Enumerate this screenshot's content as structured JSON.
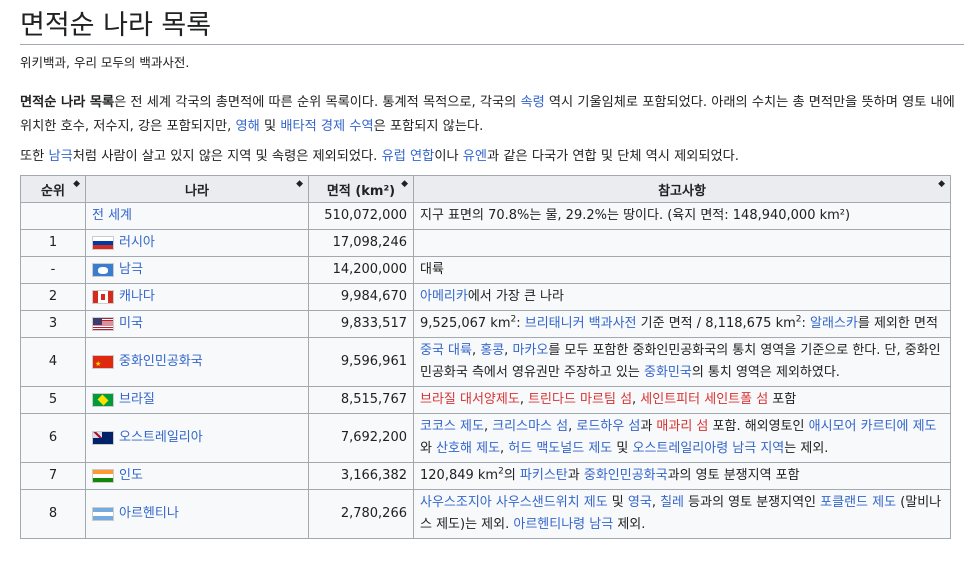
{
  "title": "면적순 나라 목록",
  "tagline": "위키백과, 우리 모두의 백과사전.",
  "intro": {
    "p1_bold": "면적순 나라 목록",
    "p1_a": "은 전 세계 각국의 총면적에 따른 순위 목록이다. 통계적 목적으로, 각국의 ",
    "p1_link1": "속령",
    "p1_b": " 역시 기울임체로 포함되었다. 아래의 수치는 총 면적만을 뜻하며 영토 내에 위치한 호수, 저수지, 강은 포함되지만, ",
    "p1_link2": "영해",
    "p1_c": " 및 ",
    "p1_link3": "배타적 경제 수역",
    "p1_d": "은 포함되지 않는다.",
    "p2_a": "또한 ",
    "p2_link1": "남극",
    "p2_b": "처럼 사람이 살고 있지 않은 지역 및 속령은 제외되었다. ",
    "p2_link2": "유럽 연합",
    "p2_c": "이나 ",
    "p2_link3": "유엔",
    "p2_d": "과 같은 다국가 연합 및 단체 역시 제외되었다."
  },
  "table": {
    "headers": {
      "rank": "순위",
      "country": "나라",
      "area": "면적 (km²)",
      "notes": "참고사항"
    },
    "sort_icon": "◆",
    "rows": [
      {
        "rank": "",
        "country": "전 세계",
        "flag": "",
        "area": "510,072,000",
        "notes": "지구 표면의 70.8%는 물, 29.2%는 땅이다. (육지 면적: 148,940,000 km²)"
      },
      {
        "rank": "1",
        "country": "러시아",
        "flag": "ru",
        "area": "17,098,246",
        "notes": ""
      },
      {
        "rank": "-",
        "country": "남극",
        "flag": "aq",
        "area": "14,200,000",
        "notes": "대륙"
      },
      {
        "rank": "2",
        "country": "캐나다",
        "flag": "ca",
        "area": "9,984,670",
        "notes": ""
      },
      {
        "rank": "3",
        "country": "미국",
        "flag": "us",
        "area": "9,833,517",
        "notes": ""
      },
      {
        "rank": "4",
        "country": "중화인민공화국",
        "flag": "cn",
        "area": "9,596,961",
        "notes": ""
      },
      {
        "rank": "5",
        "country": "브라질",
        "flag": "br",
        "area": "8,515,767",
        "notes": ""
      },
      {
        "rank": "6",
        "country": "오스트레일리아",
        "flag": "au",
        "area": "7,692,200",
        "notes": ""
      },
      {
        "rank": "7",
        "country": "인도",
        "flag": "in",
        "area": "3,166,382",
        "notes": ""
      },
      {
        "rank": "8",
        "country": "아르헨티나",
        "flag": "ar",
        "area": "2,780,266",
        "notes": ""
      }
    ],
    "note_ca": {
      "link": "아메리카",
      "rest": "에서 가장 큰 나라"
    },
    "note_us": {
      "a": "9,525,067 km",
      "b": ": ",
      "link1": "브리태니커 백과사전",
      "c": " 기준 면적 / 8,118,675 km",
      "d": ": ",
      "link2": "알래스카",
      "e": "를 제외한 면적"
    },
    "note_cn": {
      "link1": "중국 대륙",
      "s1": ", ",
      "link2": "홍콩",
      "s2": ", ",
      "link3": "마카오",
      "s3": "를 모두 포함한 중화인민공화국의 통치 영역을 기준으로 한다. 단, 중화인민공화국 측에서 영유권만 주장하고 있는 ",
      "link4": "중화민국",
      "s4": "의 통치 영역은 제외하였다."
    },
    "note_br": {
      "red1": "브라질 대서양제도",
      "s1": ", ",
      "red2": "트린다드 마르팀 섬",
      "s2": ", ",
      "red3": "세인트피터 세인트폴 섬",
      "s3": " 포함"
    },
    "note_au": {
      "link1": "코코스 제도",
      "s1": ", ",
      "link2": "크리스마스 섬",
      "s2": ", ",
      "link3": "로드하우 섬",
      "s3": "과 ",
      "red1": "매과리 섬",
      "s4": " 포함. 해외영토인 ",
      "link4": "애시모어 카르티에 제도",
      "s5": "와 ",
      "link5": "산호해 제도",
      "s6": ", ",
      "link6": "허드 맥도널드 제도",
      "s7": " 및 ",
      "link7": "오스트레일리아령 남극 지역",
      "s8": "는 제외."
    },
    "note_in": {
      "a": "120,849 km",
      "b": "의 ",
      "link1": "파키스탄",
      "c": "과 ",
      "link2": "중화인민공화국",
      "d": "과의 영토 분쟁지역 포함"
    },
    "note_ar": {
      "link1": "사우스조지아 사우스샌드위치 제도",
      "s1": " 및 ",
      "link2": "영국",
      "s2": ", ",
      "link3": "칠레",
      "s3": " 등과의 영토 분쟁지역인 ",
      "link4": "포클랜드 제도",
      "s4": " (말비나스 제도)는 제외. ",
      "link5": "아르헨티나령 남극",
      "s5": " 제외."
    }
  },
  "colors": {
    "link": "#3366cc",
    "redlink": "#d73333",
    "header_bg": "#eaecf0",
    "cell_bg": "#f8f9fa",
    "border": "#a2a9b1"
  }
}
